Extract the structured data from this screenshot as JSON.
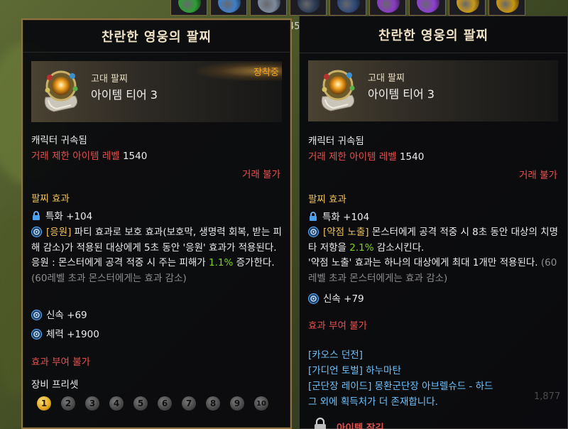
{
  "top_bar": {
    "slots": [
      {
        "color": "#2e9e34"
      },
      {
        "color": "#3f7fc9"
      },
      {
        "color": "#7b8a9b"
      },
      {
        "color": "#2d3c55"
      },
      {
        "color": "#2f4a7a"
      },
      {
        "color": "#8b3bc4"
      },
      {
        "color": "#8f3fd2"
      },
      {
        "color": "#c99a1a"
      },
      {
        "color": "#c9950f"
      }
    ],
    "corner_count": "45"
  },
  "left_tooltip": {
    "title": "찬란한 영웅의 팔찌",
    "grade": "고대 팔찌",
    "tier": "아이템 티어 3",
    "equipped": "장착중",
    "bound": "캐릭터 귀속됨",
    "restriction_label": "거래 제한 아이템 레벨",
    "restriction_value": "1540",
    "trade": "거래 불가",
    "effect_heading": "팔찌 효과",
    "stat_1": "특화 +104",
    "effect_tag": "[응원]",
    "effect_text_1": "파티 효과로 보호 효과(보호막, 생명력 회복, 받는 피해 감소)가 적용된 대상에게 5초 동안 '응원' 효과가 적용된다.",
    "effect_text_2_pre": "응원 : 몬스터에게 공격 적중 시 주는 피해가",
    "effect_value": "1.1%",
    "effect_text_2_post": "증가한다.",
    "effect_note": "(60레벨 초과 몬스터에게는 효과 감소)",
    "stat_2": "신속 +69",
    "stat_3": "체력 +1900",
    "no_grant": "효과 부여 불가",
    "preset_label": "장비 프리셋",
    "presets": [
      "1",
      "2",
      "3",
      "4",
      "5",
      "6",
      "7",
      "8",
      "9",
      "10"
    ],
    "active_preset": "1"
  },
  "right_tooltip": {
    "title": "찬란한 영웅의 팔찌",
    "grade": "고대 팔찌",
    "tier": "아이템 티어 3",
    "bound": "캐릭터 귀속됨",
    "restriction_label": "거래 제한 아이템 레벨",
    "restriction_value": "1540",
    "trade": "거래 불가",
    "effect_heading": "팔찌 효과",
    "stat_1": "특화 +104",
    "effect_tag": "[약점 노출]",
    "effect_text_1_pre": "몬스터에게 공격 적중 시 8초 동안 대상의 치명타 저항을",
    "effect_value": "2.1%",
    "effect_text_1_post": "감소시킨다.",
    "effect_text_2": "'약점 노출' 효과는 하나의 대상에게 최대 1개만 적용된다.",
    "effect_note": "(60레벨 초과 몬스터에게는 효과 감소)",
    "stat_2": "신속 +79",
    "no_grant": "효과 부여 불가",
    "sources": [
      "[카오스 던전]",
      "[가디언 토벌] 하누마탄",
      "[군단장 레이드] 몽환군단장 아브렐슈드 - 하드",
      "그 외에 획득처가 더 존재합니다."
    ],
    "lock_label": "아이템 잠김",
    "faint_number": "1,877"
  }
}
